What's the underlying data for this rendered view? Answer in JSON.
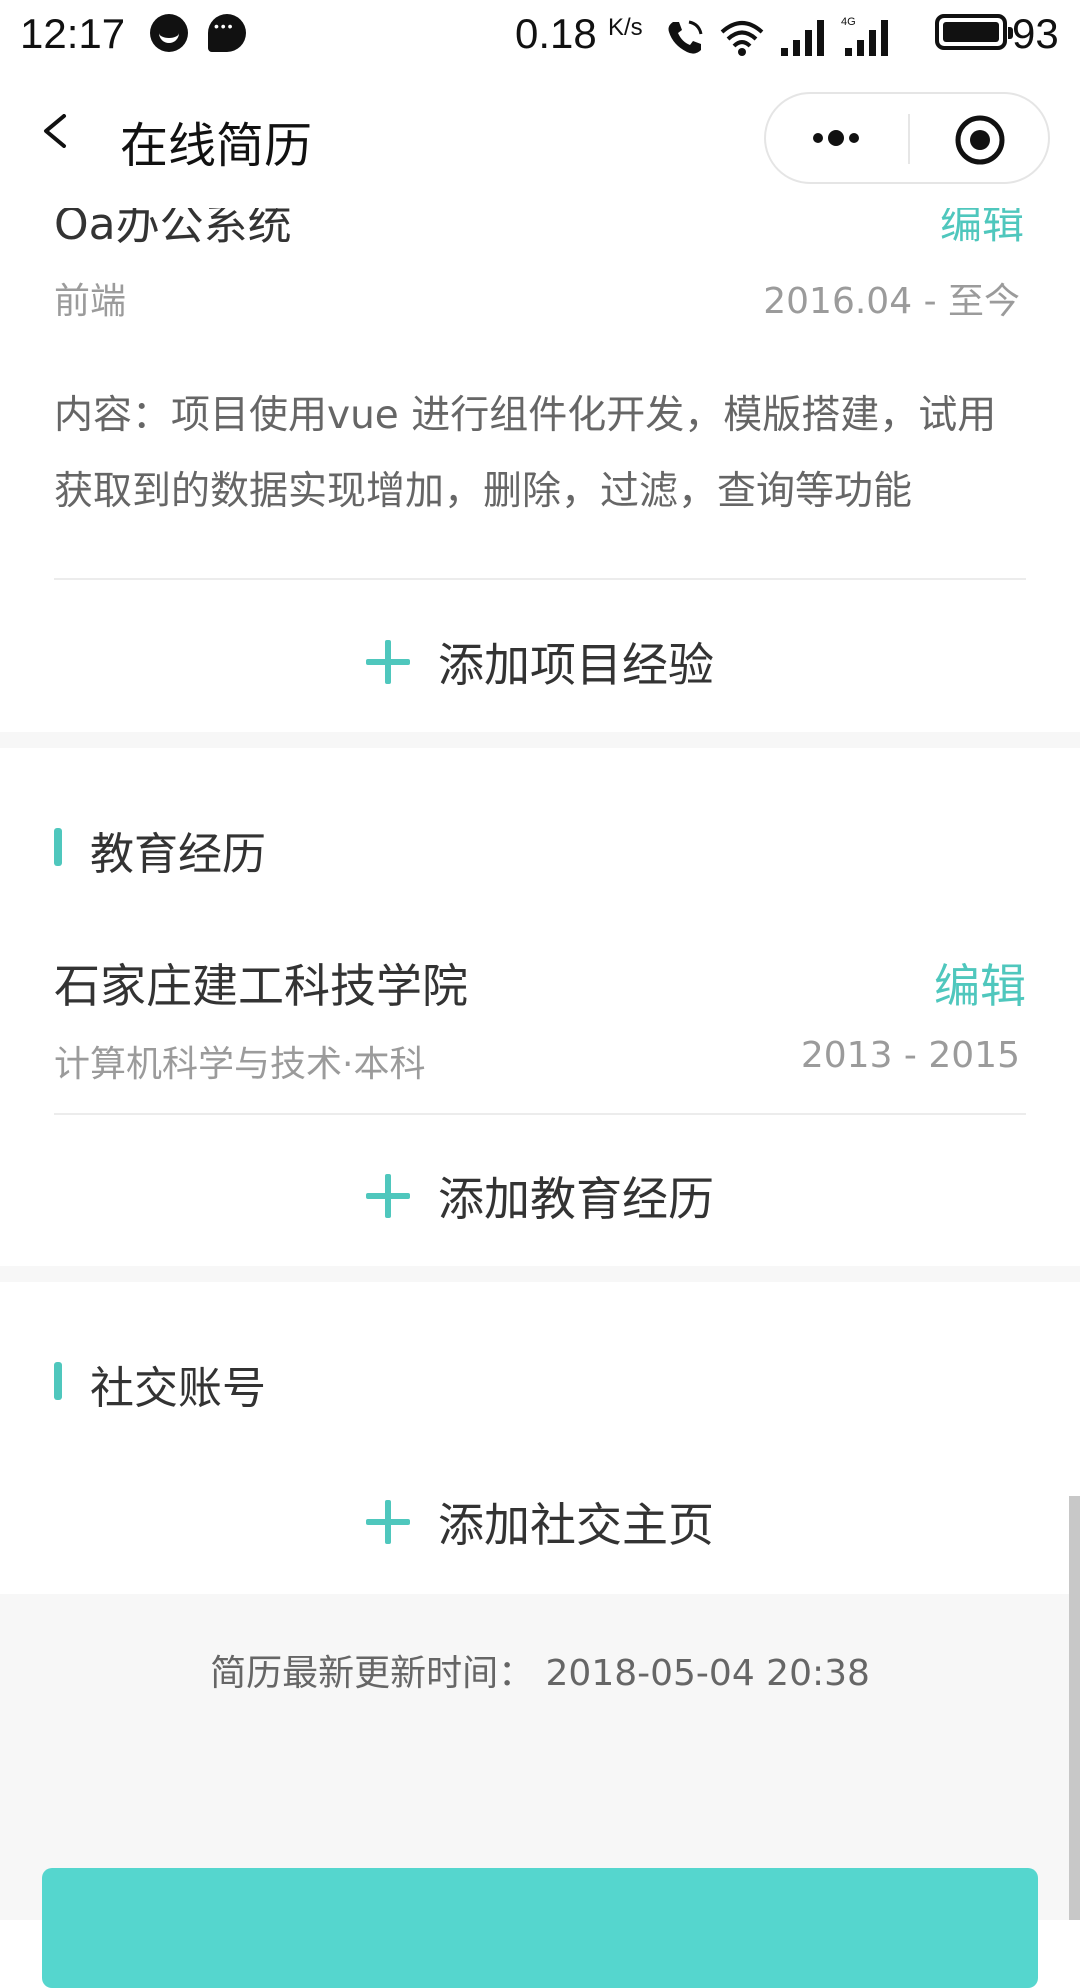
{
  "status_bar": {
    "time": "12:17",
    "net_speed": "0.18",
    "net_speed_unit": "K/s",
    "battery": "93",
    "icons": [
      "emoji-app-icon",
      "chat-app-icon",
      "phone-call-icon",
      "wifi-icon",
      "signal-icon",
      "signal-4g-icon",
      "battery-icon"
    ]
  },
  "nav": {
    "title": "在线简历"
  },
  "project": {
    "name": "Oa办公系统",
    "edit": "编辑",
    "role": "前端",
    "date": "2016.04 - 至今",
    "description": "内容：项目使用vue 进行组件化开发，模版搭建，试用获取到的数据实现增加，删除，过滤，查询等功能",
    "add_label": "添加项目经验"
  },
  "education": {
    "section_title": "教育经历",
    "school": "石家庄建工科技学院",
    "edit": "编辑",
    "major": "计算机科学与技术·本科",
    "years": "2013 - 2015",
    "add_label": "添加教育经历"
  },
  "social": {
    "section_title": "社交账号",
    "add_label": "添加社交主页"
  },
  "footer": {
    "update_time": "简历最新更新时间： 2018-05-04 20:38"
  },
  "colors": {
    "accent": "#4fc7bd",
    "button": "#55d6ce",
    "band": "#f7f7f7"
  }
}
